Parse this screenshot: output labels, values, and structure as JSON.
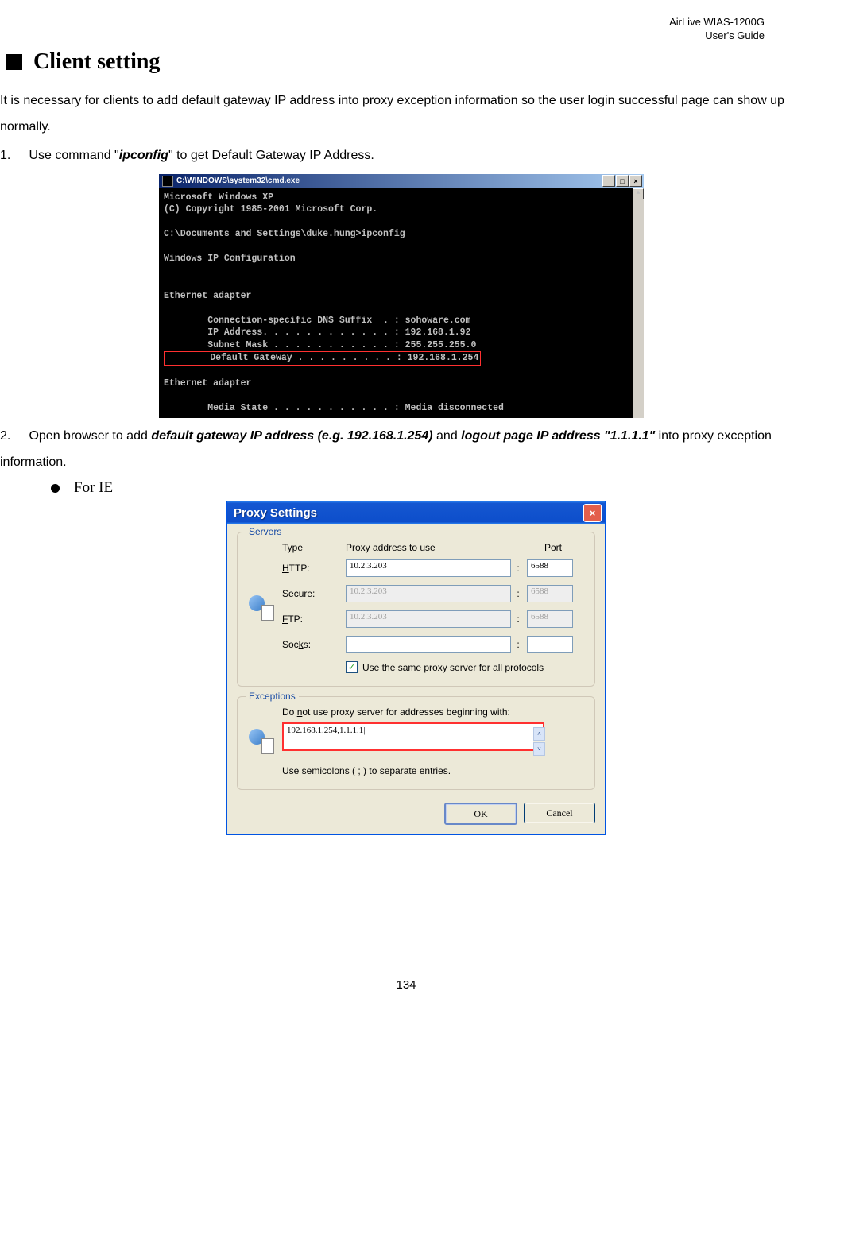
{
  "header": {
    "product": "AirLive WIAS-1200G",
    "doc": "User's Guide"
  },
  "title": "Client setting",
  "intro": "It is necessary for clients to add default gateway IP address into proxy exception information so the user login successful page can show up normally.",
  "step1": {
    "num": "1.",
    "pre": "Use command \"",
    "cmd": "ipconfig",
    "post": "\" to get Default Gateway IP Address."
  },
  "cmd": {
    "title": "C:\\WINDOWS\\system32\\cmd.exe",
    "line1": "Microsoft Windows XP",
    "line2": "(C) Copyright 1985-2001 Microsoft Corp.",
    "line3": "C:\\Documents and Settings\\duke.hung>ipconfig",
    "line4": "Windows IP Configuration",
    "line5": "Ethernet adapter",
    "line6": "        Connection-specific DNS Suffix  . : sohoware.com",
    "line7": "        IP Address. . . . . . . . . . . . : 192.168.1.92",
    "line8": "        Subnet Mask . . . . . . . . . . . : 255.255.255.0",
    "line9": "        Default Gateway . . . . . . . . . : 192.168.1.254",
    "line10": "Ethernet adapter",
    "line11": "        Media State . . . . . . . . . . . : Media disconnected"
  },
  "step2": {
    "num": "2.",
    "pre": "Open browser to add ",
    "bold1": "default gateway IP address (e.g. 192.168.1.254)",
    "mid": " and ",
    "bold2": "logout page IP address \"1.1.1.1\"",
    "post": " into proxy exception information."
  },
  "sub": "For IE",
  "proxy": {
    "title": "Proxy Settings",
    "servers_legend": "Servers",
    "header_type": "Type",
    "header_addr": "Proxy address to use",
    "header_port": "Port",
    "http_label_pre": "",
    "http_u": "H",
    "http_label": "TTP:",
    "http_addr": "10.2.3.203",
    "http_port": "6588",
    "secure_u": "S",
    "secure_label": "ecure:",
    "secure_addr": "10.2.3.203",
    "secure_port": "6588",
    "ftp_u": "F",
    "ftp_label": "TP:",
    "ftp_addr": "10.2.3.203",
    "ftp_port": "6588",
    "socks_pre": "Soc",
    "socks_u": "k",
    "socks_label": "s:",
    "socks_addr": "",
    "socks_port": "",
    "check_u": "U",
    "check_rest": "se the same proxy server for all protocols",
    "exc_legend": "Exceptions",
    "exc_pre": "Do ",
    "exc_u": "n",
    "exc_rest": "ot use proxy server for addresses beginning with:",
    "exc_value": "192.168.1.254,1.1.1.1|",
    "exc_note": "Use semicolons ( ; ) to separate entries.",
    "ok": "OK",
    "cancel": "Cancel"
  },
  "page_num": "134"
}
